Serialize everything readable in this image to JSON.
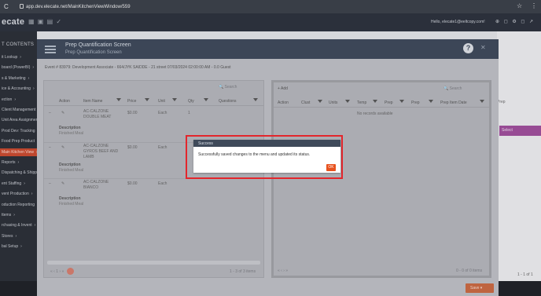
{
  "browser": {
    "url": "app.dev.elecate.net/MainKitchenViewWindow/559",
    "back_icon": "C",
    "menu_glyph": "⋮",
    "star_glyph": "☆"
  },
  "app": {
    "logo": "ecate",
    "hello": "Hello, elecate1@eeltcopy.com!",
    "top_icons": "⊕ ◻ ⚙ ◻ ↗"
  },
  "sidebar": {
    "header": "T CONTENTS",
    "items": [
      {
        "label": "it Lookup"
      },
      {
        "label": "board (PowerBI)"
      },
      {
        "label": "s & Marketing"
      },
      {
        "label": "ice & Accounting"
      },
      {
        "label": "ection"
      },
      {
        "label": "Client Management"
      },
      {
        "label": "Unit Area Assignment"
      },
      {
        "label": "Prod Dev: Tracking"
      },
      {
        "label": "Food Prep Product"
      },
      {
        "label": "Main Kitchen View",
        "active": true
      },
      {
        "label": "Reports"
      },
      {
        "label": "Dispatching & Shipping"
      },
      {
        "label": "ent Staffing"
      },
      {
        "label": "vent Production"
      },
      {
        "label": "oduction Reporting"
      },
      {
        "label": "ttems"
      },
      {
        "label": "rchasing & Invent"
      },
      {
        "label": "Stores"
      },
      {
        "label": "bal Setup"
      }
    ]
  },
  "modal": {
    "title": "Prep Quantification Screen",
    "subtitle": "Prep Quantification Screen",
    "event_info": "Event # 83979: Development Associate - 664/JYK SAIDDE - 21 street 07/03/2024 02:00:00 AM - 0.0 Guest",
    "left_panel": {
      "search_placeholder": "Search",
      "columns": [
        "Action",
        "Item Name",
        "Price",
        "Unit",
        "Qty",
        "Questions"
      ],
      "rows": [
        {
          "name_line1": "AC-CALZONE",
          "name_line2": "DOUBLE MEAT",
          "price": "$0.00",
          "unit": "Each",
          "qty": "1",
          "desc_label": "Description",
          "desc": "Finished Meal"
        },
        {
          "name_line1": "AC-CALZONE",
          "name_line2": "GYROS BEEF AND",
          "name_line3": "LAMB",
          "price": "$0.00",
          "unit": "Each",
          "qty": "",
          "desc_label": "Description",
          "desc": "Finished Meal"
        },
        {
          "name_line1": "AC-CALZONE",
          "name_line2": "BIANCO",
          "price": "$0.00",
          "unit": "Each",
          "qty": "",
          "desc_label": "Description",
          "desc": "Finished Meal"
        }
      ],
      "pagination": "1 - 3 of 3 items",
      "page_nav": "«  ‹   1   ›  »"
    },
    "right_panel": {
      "add_label": "+ Add",
      "search_placeholder": "Search",
      "columns": [
        "Action",
        "Clust",
        "Units",
        "Temp",
        "Prep",
        "Prep",
        "Prep Item Date"
      ],
      "no_records": "No records available",
      "pagination": "0 - 0 of 0 items",
      "page_nav": "«  ‹   ›  »"
    },
    "save_label": "Save  ▾"
  },
  "right_bg": {
    "label": "Prep",
    "select_label": "Select",
    "pagination": "1 - 1 of 1"
  },
  "dialog": {
    "title": "Success",
    "message": "Successfully saved changes to the menu and updated its status.",
    "ok_label": "OK"
  },
  "colors": {
    "accent": "#e8521e",
    "highlight": "#e3262c",
    "sidebar_active": "#c4492e"
  }
}
